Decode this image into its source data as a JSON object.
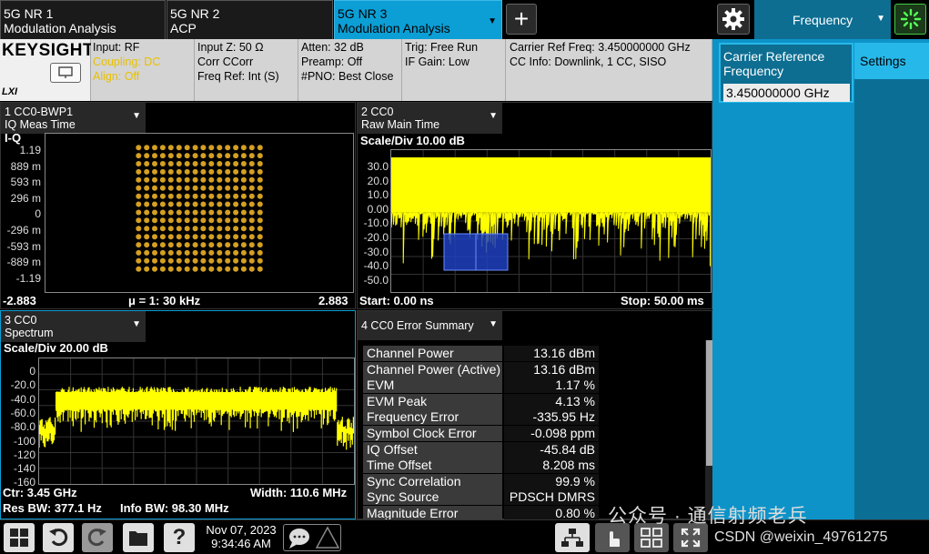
{
  "tabs": [
    {
      "line1": "5G NR 1",
      "line2": "Modulation Analysis"
    },
    {
      "line1": "5G NR 2",
      "line2": "ACP"
    },
    {
      "line1": "5G NR 3",
      "line2": "Modulation Analysis"
    }
  ],
  "add_tab": "+",
  "menu_panel": {
    "title": "Frequency"
  },
  "brand": "KEYSIGHT",
  "lxi": "LXI",
  "settings": {
    "input": "Input: RF",
    "coupling": "Coupling: DC",
    "align": "Align: Off",
    "inputz": "Input Z: 50 Ω",
    "corr": "Corr CCorr",
    "freqref": "Freq Ref: Int (S)",
    "atten": "Atten: 32 dB",
    "preamp": "Preamp: Off",
    "pno": "#PNO: Best Close",
    "trig": "Trig: Free Run",
    "ifgain": "IF Gain: Low",
    "carrier": "Carrier Ref Freq: 3.450000000 GHz",
    "ccinfo": "CC Info: Downlink, 1 CC, SISO"
  },
  "win1": {
    "title1": "1 CC0-BWP1",
    "title2": "IQ Meas Time",
    "label": "I-Q",
    "yticks": [
      "1.19",
      "889 m",
      "593 m",
      "296 m",
      "0",
      "-296 m",
      "-593 m",
      "-889 m",
      "-1.19"
    ],
    "left": "-2.883",
    "mid": "μ = 1: 30 kHz",
    "right": "2.883"
  },
  "win2": {
    "title1": "2 CC0",
    "title2": "Raw Main Time",
    "scale": "Scale/Div 10.00 dB",
    "yticks": [
      "30.0",
      "20.0",
      "10.0",
      "0.00",
      "-10.0",
      "-20.0",
      "-30.0",
      "-40.0",
      "-50.0"
    ],
    "start": "Start: 0.00 ns",
    "stop": "Stop: 50.00 ms"
  },
  "win3": {
    "title1": "3 CC0",
    "title2": "Spectrum",
    "scale": "Scale/Div 20.00 dB",
    "yticks": [
      "0",
      "-20.0",
      "-40.0",
      "-60.0",
      "-80.0",
      "-100",
      "-120",
      "-140",
      "-160"
    ],
    "ctr": "Ctr: 3.45 GHz",
    "width": "Width: 110.6 MHz",
    "resbw": "Res BW: 377.1 Hz",
    "infobw": "Info BW: 98.30 MHz"
  },
  "win4": {
    "title": "4 CC0 Error Summary",
    "rows": [
      {
        "label": "Channel Power",
        "value": "13.16 dBm"
      },
      {
        "label": "Channel Power (Active)",
        "value": "13.16 dBm"
      },
      {
        "label": "EVM",
        "value": "1.17 %"
      },
      {
        "label": "EVM Peak",
        "value": "4.13 %"
      },
      {
        "label": "Frequency Error",
        "value": "-335.95 Hz"
      },
      {
        "label": "Symbol Clock Error",
        "value": "-0.098 ppm"
      },
      {
        "label": "IQ Offset",
        "value": "-45.84 dB"
      },
      {
        "label": "Time Offset",
        "value": "8.208 ms"
      },
      {
        "label": "Sync Correlation",
        "value": "99.9 %"
      },
      {
        "label": "Sync Source",
        "value": "PDSCH DMRS"
      },
      {
        "label": "Magnitude Error",
        "value": "0.80 %"
      }
    ]
  },
  "sidepanel": {
    "field_label_1": "Carrier Reference",
    "field_label_2": "Frequency",
    "field_value": "3.450000000 GHz",
    "settings_tab": "Settings"
  },
  "taskbar": {
    "date": "Nov 07, 2023",
    "time": "9:34:46 AM"
  },
  "watermark": {
    "line1": "公众号 · 通信射频老兵",
    "line2": "CSDN @weixin_49761275"
  },
  "colors": {
    "accent": "#0b9fd6",
    "trace": "#ffff00",
    "constellation": "#d4a020",
    "burst": "#1f3fbf"
  }
}
